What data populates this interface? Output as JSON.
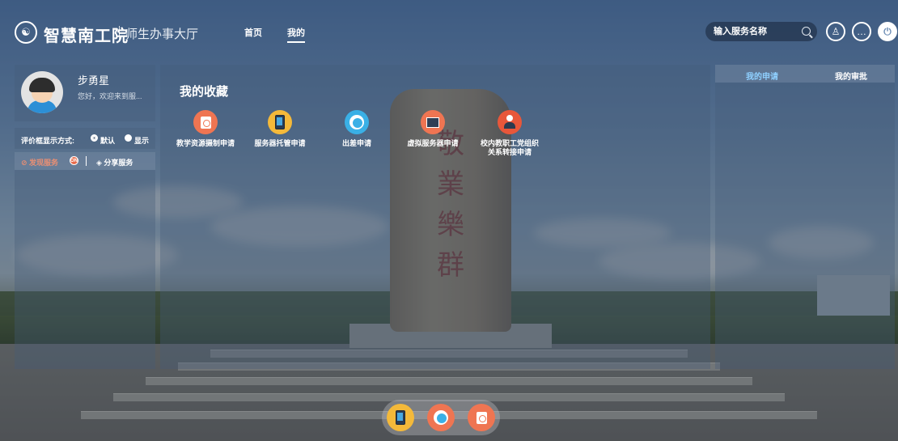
{
  "header": {
    "logo_glyph": "☯",
    "brand": "智慧南工院",
    "subtitle": "师生办事大厅",
    "nav": [
      {
        "label": "首页"
      },
      {
        "label": "我的"
      }
    ],
    "search_placeholder": "输入服务名称",
    "icons": [
      "shirt-icon",
      "chat-icon",
      "power-icon"
    ],
    "icon_glyphs": {
      "shirt": "♙",
      "chat": "…",
      "power": "⏻"
    }
  },
  "profile": {
    "name": "步勇星",
    "greeting": "您好，欢迎来到服..."
  },
  "evaluation": {
    "label": "评价框显示方式:",
    "options": [
      {
        "label": "默认",
        "selected": true
      },
      {
        "label": "显示",
        "selected": false
      }
    ]
  },
  "left_tabs": {
    "find_label": "发现服务",
    "badge": "ON",
    "share_label": "分享服务"
  },
  "favorites": {
    "title": "我的收藏",
    "items": [
      {
        "label": "教学资源摄制申请",
        "icon": "camera-doc-icon",
        "color": "#ef7552"
      },
      {
        "label": "服务器托管申请",
        "icon": "tablet-icon",
        "color": "#f4b93a"
      },
      {
        "label": "出差申请",
        "icon": "globe-icon",
        "color": "#3ab0e6"
      },
      {
        "label": "虚拟服务器申请",
        "icon": "whiteboard-icon",
        "color": "#ef7552"
      },
      {
        "label": "校内教职工党组织关系转接申请",
        "label_lines": [
          "校内教职工党组织",
          "关系转接申请"
        ],
        "icon": "person-icon",
        "color": "#e8573a"
      }
    ]
  },
  "right_panel": {
    "tabs": [
      {
        "label": "我的申请",
        "active": true
      },
      {
        "label": "我的审批",
        "active": false
      }
    ]
  },
  "dock": {
    "items": [
      "tablet-icon",
      "book-icon",
      "camera-doc-icon"
    ]
  },
  "colors": {
    "accent_orange": "#ef7552",
    "accent_yellow": "#f4b93a",
    "accent_blue": "#3ab0e6",
    "active_tab": "#8fd0ff"
  }
}
